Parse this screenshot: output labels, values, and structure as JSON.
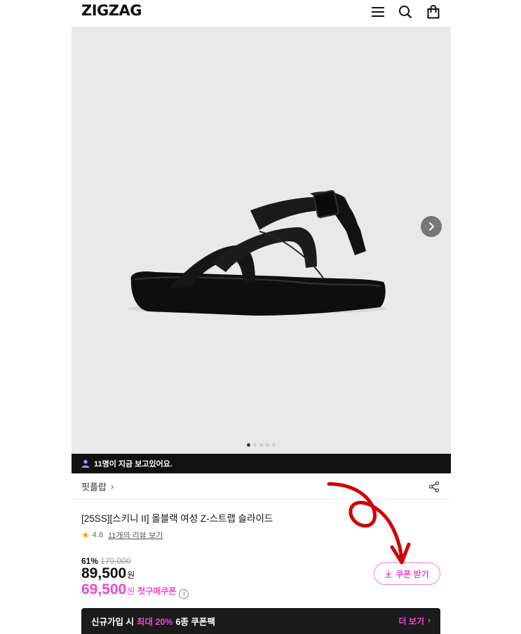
{
  "header": {
    "logo": "ZIGZAG",
    "icons": [
      "menu-icon",
      "search-icon",
      "shopping-bag-icon"
    ]
  },
  "gallery": {
    "image_subject": "black strappy slide sandal",
    "current_index": 1,
    "total_images": 5
  },
  "viewers": {
    "text": "11명이 지금 보고있어요."
  },
  "brand": {
    "name": "핏플랍"
  },
  "product": {
    "title": "[25SS][스키니 II] 올블랙 여성 Z-스트랩 슬라이드",
    "rating": "4.8",
    "reviews_link": "11개의 리뷰 보기"
  },
  "pricing": {
    "discount_pct": "61%",
    "original_price": "179,000",
    "price": "89,500",
    "won": "원",
    "coupon_price": "69,500",
    "coupon_label": "첫구매쿠폰",
    "info_symbol": "i"
  },
  "coupon_button": {
    "label": "쿠폰 받기"
  },
  "signup_banner": {
    "pre": "신규가입 시",
    "highlight": "최대 20%",
    "post": "6종 쿠폰팩",
    "more": "더 보기",
    "more_chevron": "›"
  },
  "colors": {
    "accent_pink": "#f045d0",
    "dark": "#111111",
    "annotation_red": "#d10000"
  }
}
